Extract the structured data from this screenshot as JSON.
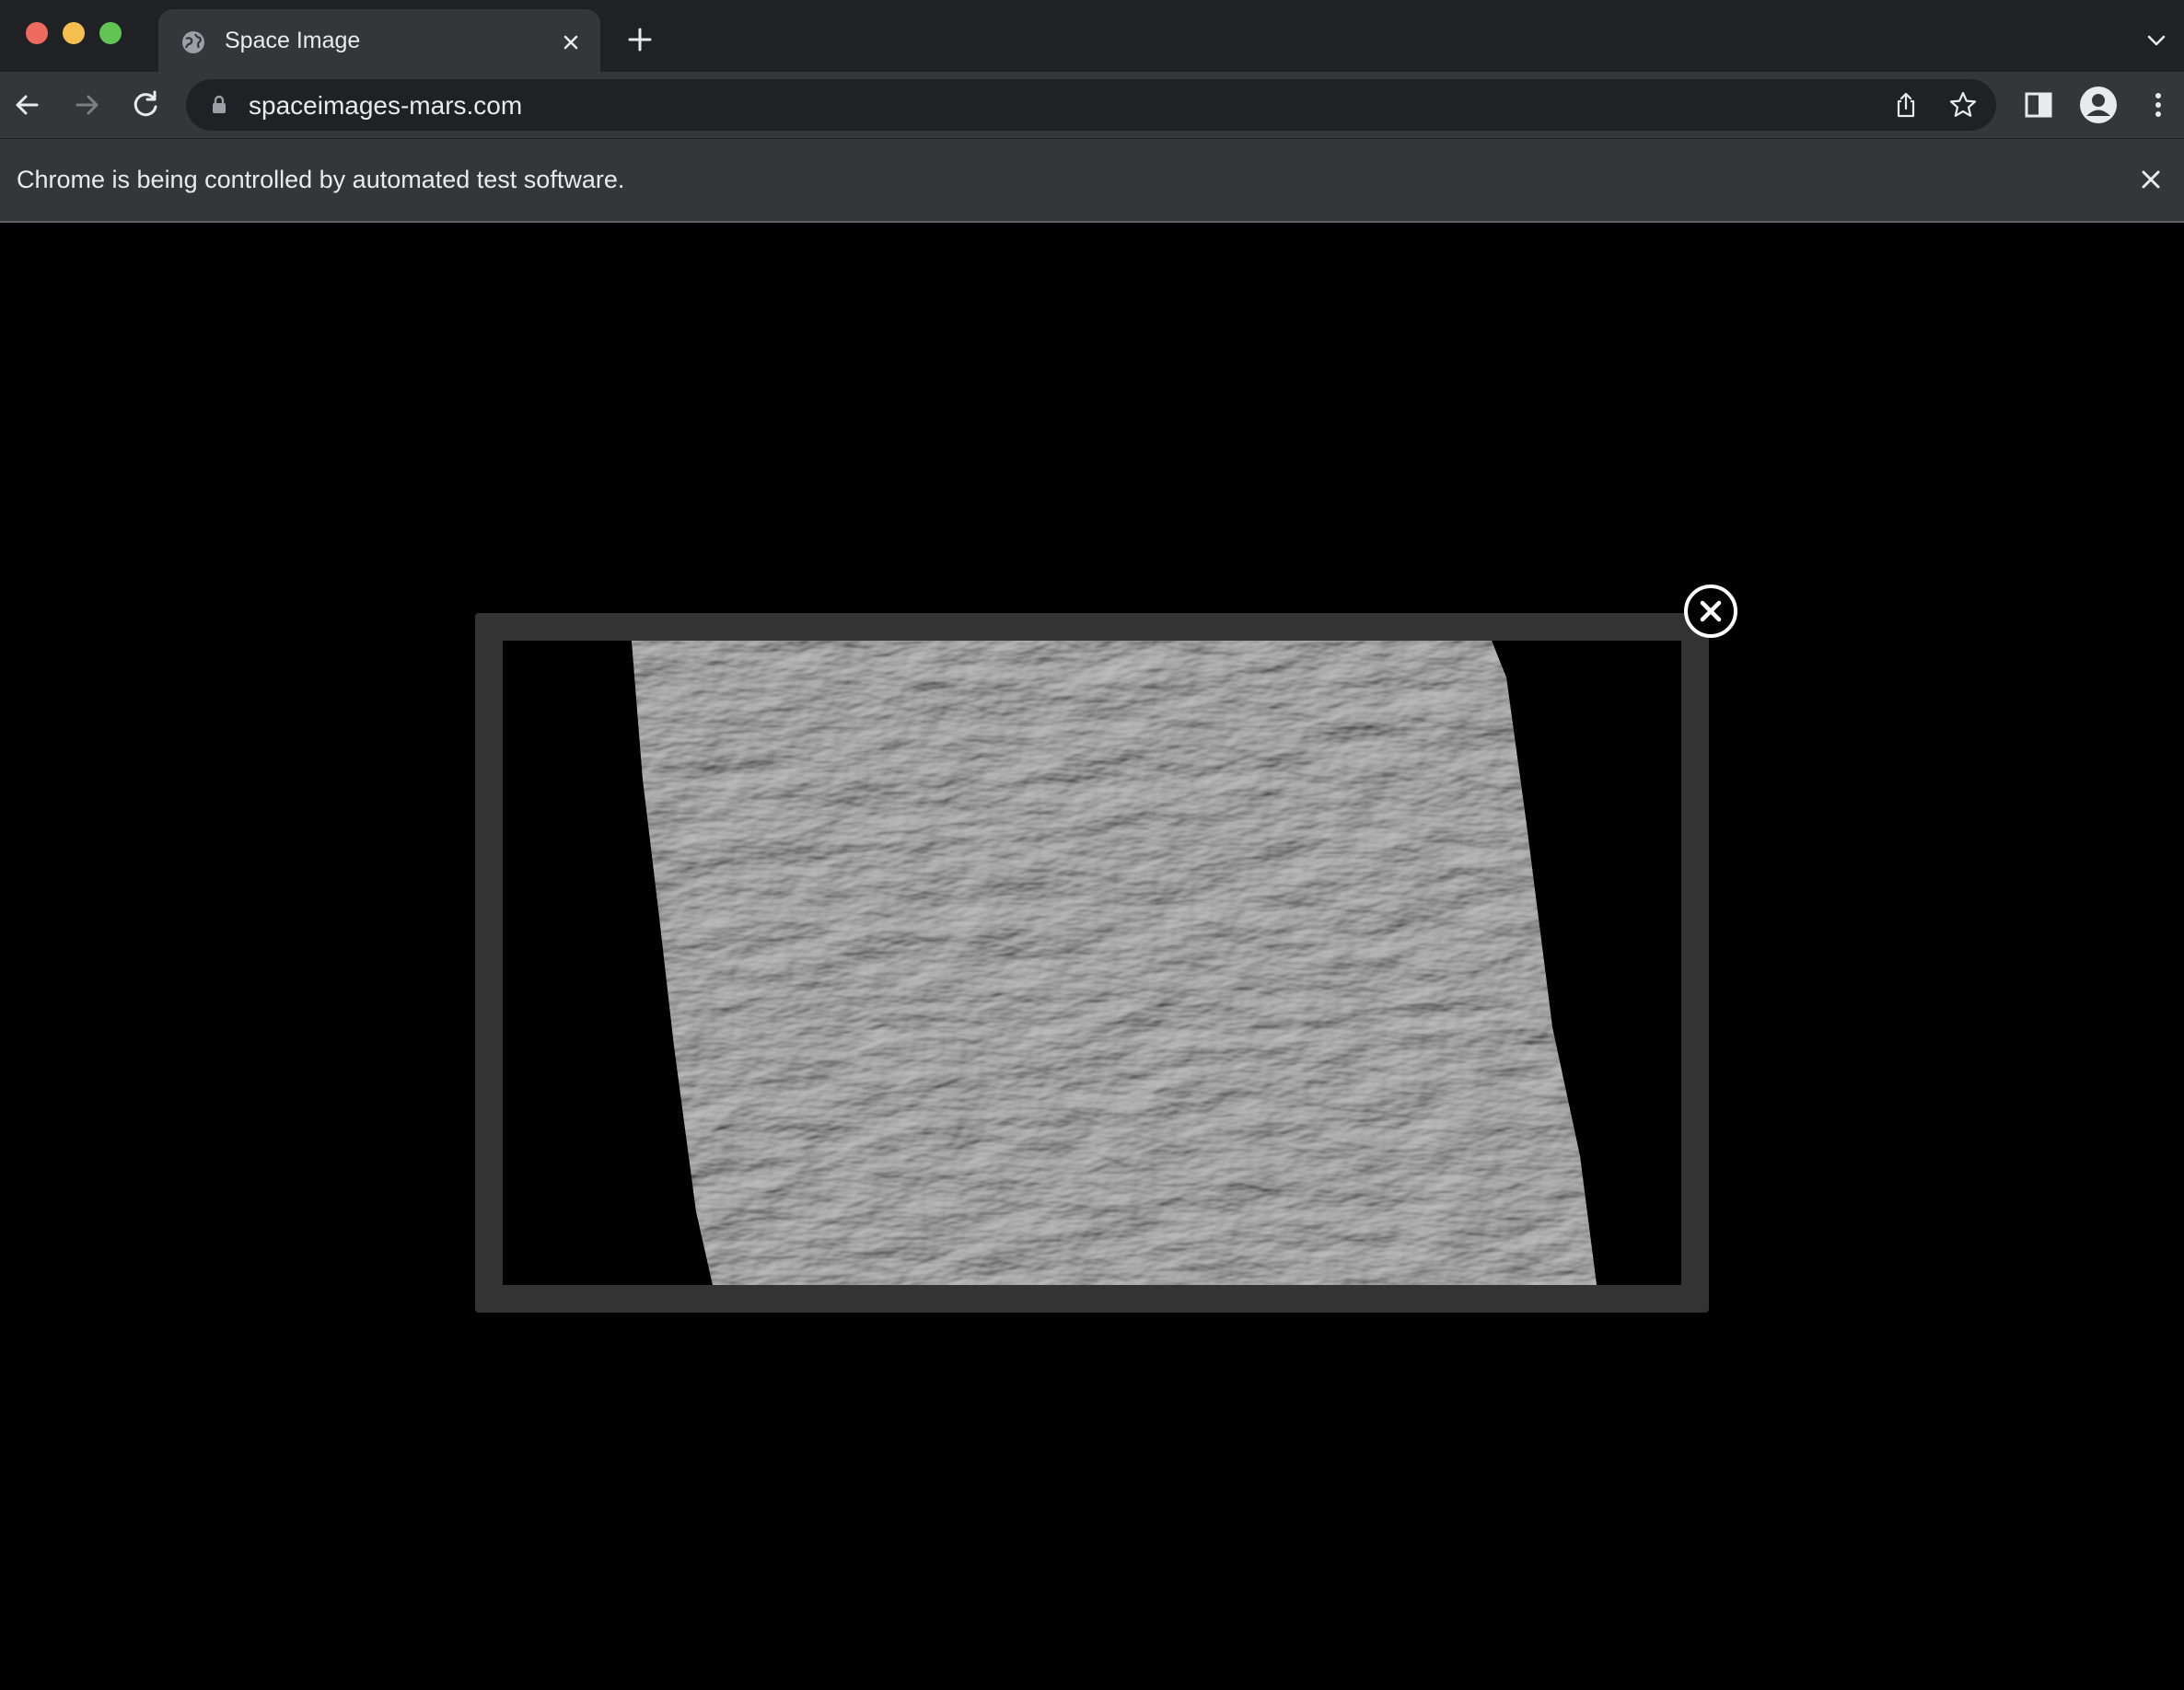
{
  "window": {
    "traffic_lights": [
      "close",
      "minimize",
      "zoom"
    ]
  },
  "tab": {
    "title": "Space Image",
    "favicon": "globe-icon",
    "close_icon": "close-icon"
  },
  "tabstrip": {
    "new_tab_icon": "plus-icon",
    "tab_search_icon": "chevron-down-icon"
  },
  "toolbar": {
    "back_icon": "back-arrow-icon",
    "forward_icon": "forward-arrow-icon",
    "reload_icon": "reload-icon",
    "url": "spaceimages-mars.com",
    "lock_icon": "lock-icon",
    "share_icon": "share-icon",
    "bookmark_icon": "star-icon",
    "side_panel_icon": "side-panel-icon",
    "profile_icon": "profile-icon",
    "menu_icon": "kebab-menu-icon"
  },
  "infobar": {
    "message": "Chrome is being controlled by automated test software.",
    "close_icon": "close-icon"
  },
  "lightbox": {
    "image_description_icon": "mars-dunes-image",
    "close_icon": "circle-close-icon"
  },
  "colors": {
    "tabstrip_bg": "#202124",
    "toolbar_bg": "#35363a",
    "page_bg": "#000000",
    "lightbox_frame": "#333333",
    "traffic_red": "#ed6a5e",
    "traffic_yellow": "#f5bf4f",
    "traffic_green": "#61c554"
  }
}
